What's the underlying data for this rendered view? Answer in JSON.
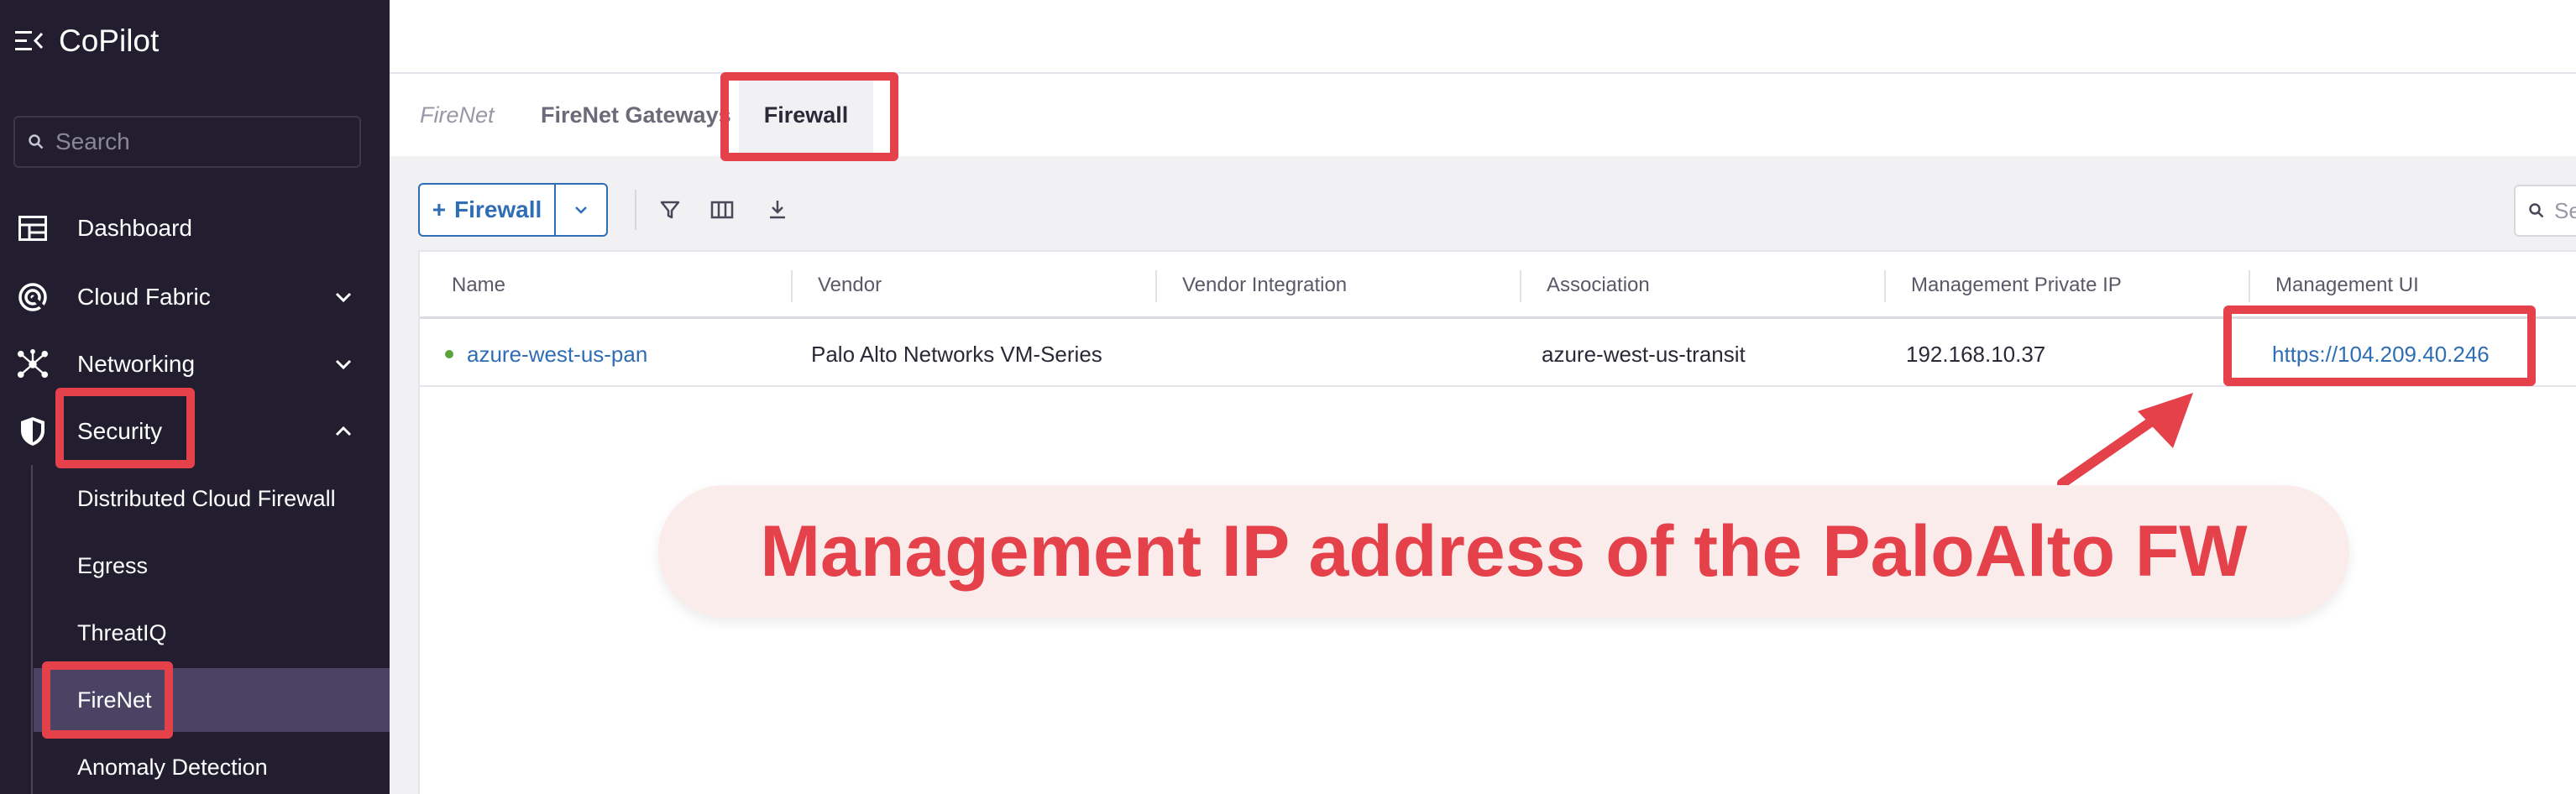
{
  "app": {
    "title": "CoPilot",
    "search_placeholder": "Search"
  },
  "sidebar": {
    "items": [
      {
        "label": "Dashboard",
        "icon": "dashboard-icon"
      },
      {
        "label": "Cloud Fabric",
        "icon": "cloud-fabric-icon",
        "expanded": false
      },
      {
        "label": "Networking",
        "icon": "networking-icon",
        "expanded": false
      },
      {
        "label": "Security",
        "icon": "shield-icon",
        "expanded": true
      }
    ],
    "security_children": [
      {
        "label": "Distributed Cloud Firewall"
      },
      {
        "label": "Egress"
      },
      {
        "label": "ThreatIQ"
      },
      {
        "label": "FireNet",
        "active": true
      },
      {
        "label": "Anomaly Detection"
      }
    ]
  },
  "tabs": {
    "breadcrumb": "FireNet",
    "gateways": "FireNet Gateways",
    "firewall": "Firewall"
  },
  "toolbar": {
    "add_label": "Firewall",
    "search_placeholder": "Se"
  },
  "table": {
    "columns": [
      "Name",
      "Vendor",
      "Vendor Integration",
      "Association",
      "Management Private IP",
      "Management UI"
    ],
    "rows": [
      {
        "name": "azure-west-us-pan",
        "vendor": "Palo Alto Networks VM-Series",
        "vendor_integration": "",
        "association": "azure-west-us-transit",
        "management_private_ip": "192.168.10.37",
        "management_ui": "https://104.209.40.246",
        "status": "up"
      }
    ]
  },
  "annotation": {
    "text": "Management IP address of the PaloAlto FW",
    "color": "#e5414b"
  },
  "colors": {
    "sidebar_bg": "#221e30",
    "accent": "#2f6db5",
    "highlight": "#e5414b",
    "status_up": "#5aa33b"
  }
}
